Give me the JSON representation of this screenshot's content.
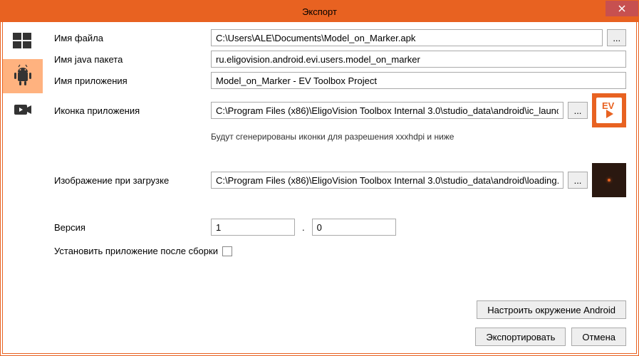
{
  "window": {
    "title": "Экспорт"
  },
  "sidebar": {
    "items": [
      {
        "name": "windows"
      },
      {
        "name": "android"
      },
      {
        "name": "video"
      }
    ]
  },
  "form": {
    "file_name_label": "Имя файла",
    "file_name_value": "C:\\Users\\ALE\\Documents\\Model_on_Marker.apk",
    "java_package_label": "Имя java пакета",
    "java_package_value": "ru.eligovision.android.evi.users.model_on_marker",
    "app_name_label": "Имя приложения",
    "app_name_value": "Model_on_Marker - EV Toolbox Project",
    "app_icon_label": "Иконка приложения",
    "app_icon_value": "C:\\Program Files (x86)\\EligoVision Toolbox Internal 3.0\\studio_data\\android\\ic_launcher.p",
    "icon_hint": "Будут сгенерированы иконки для разрешения xxxhdpi и ниже",
    "splash_label": "Изображение при загрузке",
    "splash_value": "C:\\Program Files (x86)\\EligoVision Toolbox Internal 3.0\\studio_data\\android\\loading.png",
    "version_label": "Версия",
    "version_major": "1",
    "version_minor": "0",
    "install_after_label": "Установить приложение после сборки",
    "browse_label": "..."
  },
  "buttons": {
    "configure_android": "Настроить окружение Android",
    "export": "Экспортировать",
    "cancel": "Отмена"
  }
}
